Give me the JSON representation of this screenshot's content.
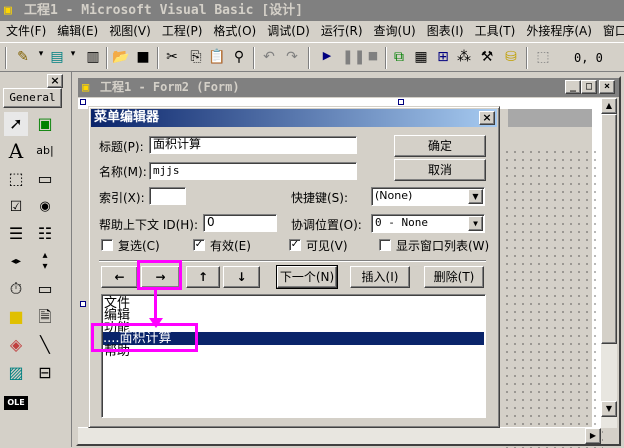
{
  "window": {
    "title": "工程1 - Microsoft Visual Basic [设计]"
  },
  "menu": [
    "文件(F)",
    "编辑(E)",
    "视图(V)",
    "工程(P)",
    "格式(O)",
    "调试(D)",
    "运行(R)",
    "查询(U)",
    "图表(I)",
    "工具(T)",
    "外接程序(A)",
    "窗口"
  ],
  "toolbar": {
    "coords": "0, 0"
  },
  "toolbox": {
    "tab": "General",
    "close": "×"
  },
  "form_window": {
    "title": "工程1 - Form2 (Form)"
  },
  "dialog": {
    "title": "菜单编辑器",
    "caption_label": "标题(P):",
    "caption_value": "面积计算",
    "name_label": "名称(M):",
    "name_value": "mjjs",
    "index_label": "索引(X):",
    "index_value": "",
    "shortcut_label": "快捷键(S):",
    "shortcut_value": "(None)",
    "help_label": "帮助上下文 ID(H):",
    "help_value": "0",
    "negotiate_label": "协调位置(O):",
    "negotiate_value": "0 - None",
    "ok": "确定",
    "cancel": "取消",
    "checkboxes": [
      {
        "label": "复选(C)",
        "checked": false
      },
      {
        "label": "有效(E)",
        "checked": true
      },
      {
        "label": "可见(V)",
        "checked": true
      },
      {
        "label": "显示窗口列表(W)",
        "checked": false
      }
    ],
    "arrows": {
      "left": "←",
      "right": "→",
      "up": "↑",
      "down": "↓"
    },
    "next": "下一个(N)",
    "insert": "插入(I)",
    "delete": "删除(T)",
    "items": [
      "文件",
      "编辑",
      "功能",
      "....面积计算",
      "帮助"
    ],
    "selected_index": 3
  }
}
